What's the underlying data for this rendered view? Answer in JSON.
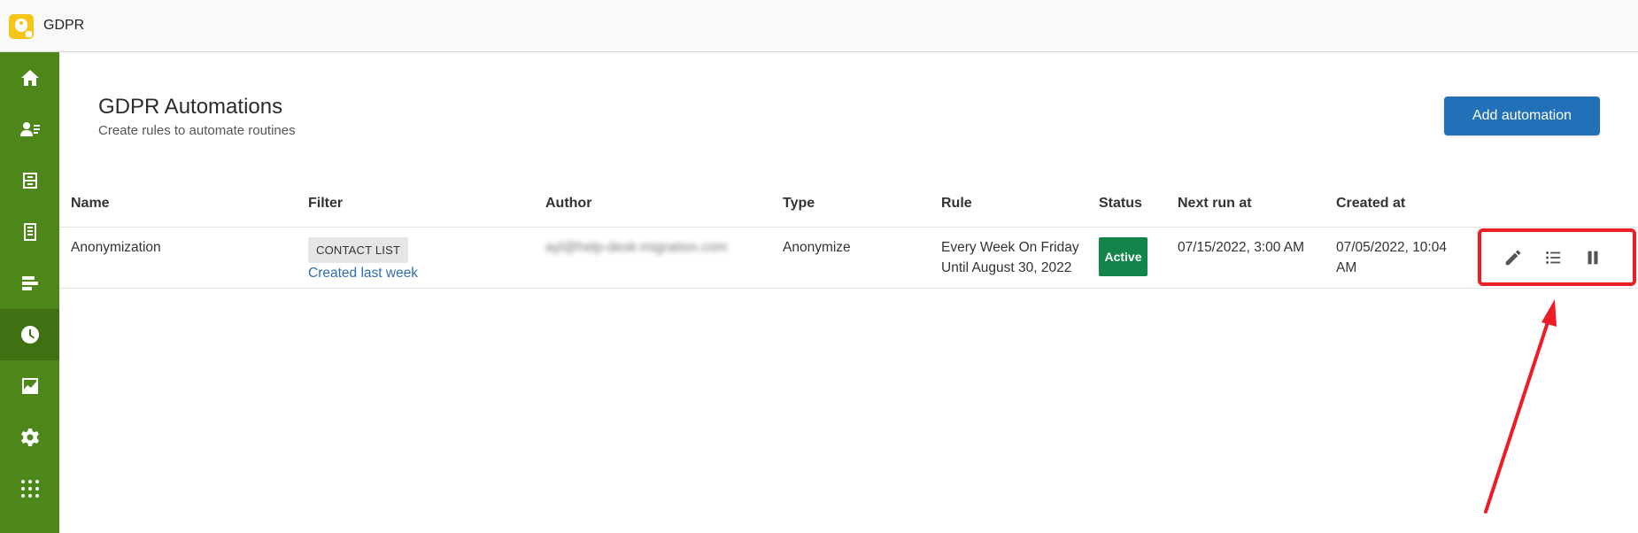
{
  "app": {
    "title": "GDPR"
  },
  "sidebar": {
    "items": [
      {
        "name": "home",
        "icon": "home-icon"
      },
      {
        "name": "contacts",
        "icon": "contact-list-icon"
      },
      {
        "name": "inbox",
        "icon": "inbox-icon"
      },
      {
        "name": "document",
        "icon": "document-icon"
      },
      {
        "name": "reports",
        "icon": "bars-icon"
      },
      {
        "name": "automations",
        "icon": "clock-icon",
        "active": true
      },
      {
        "name": "analytics",
        "icon": "chart-icon"
      },
      {
        "name": "settings",
        "icon": "gear-icon"
      },
      {
        "name": "apps",
        "icon": "grid-icon"
      }
    ],
    "colors": {
      "background": "#4d8719",
      "active": "#3f7113"
    }
  },
  "header": {
    "title": "GDPR Automations",
    "subtitle": "Create rules to automate routines",
    "add_button": "Add automation"
  },
  "table": {
    "columns": [
      "Name",
      "Filter",
      "Author",
      "Type",
      "Rule",
      "Status",
      "Next run at",
      "Created at"
    ],
    "rows": [
      {
        "name": "Anonymization",
        "filter_tag": "CONTACT LIST",
        "filter_link": "Created last week",
        "author": "ayl@help-desk-migration.com",
        "type": "Anonymize",
        "rule_line1": "Every Week On Friday",
        "rule_line2": "Until August 30, 2022",
        "status": "Active",
        "next_run": "07/15/2022, 3:00 AM",
        "created_line1": "07/05/2022, 10:04",
        "created_line2": "AM",
        "actions": [
          "pencil-icon",
          "list-icon",
          "pause-icon"
        ]
      }
    ]
  },
  "colors": {
    "accent": "#2271b8",
    "status_active": "#13854a",
    "highlight": "#ee1c25"
  }
}
